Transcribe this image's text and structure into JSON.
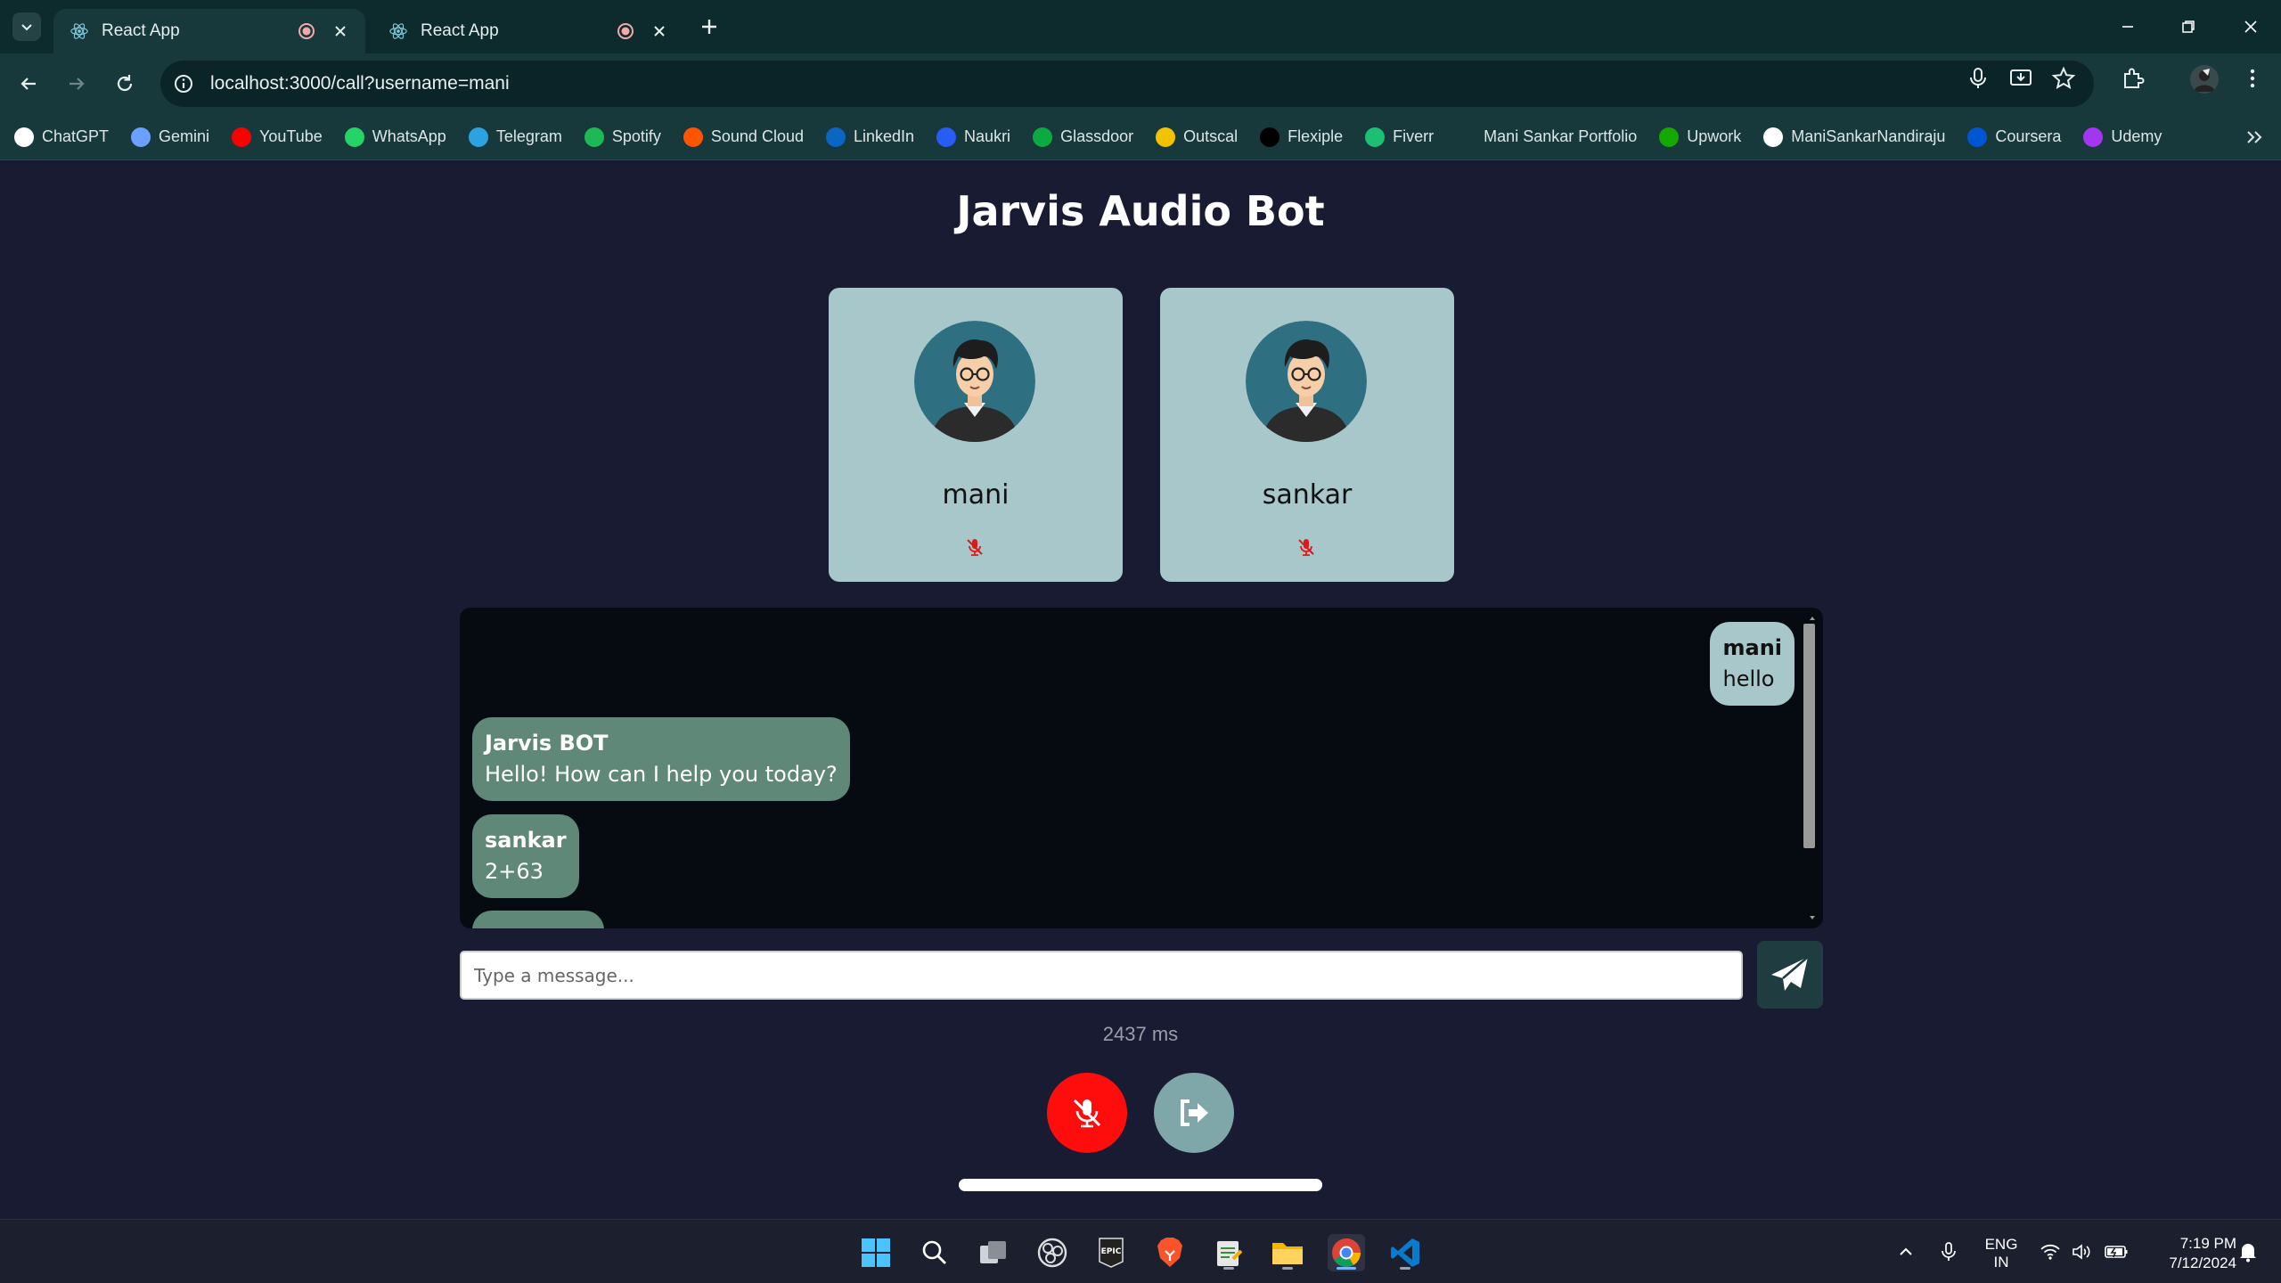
{
  "browser": {
    "tabs": [
      {
        "title": "React App",
        "active": true,
        "recording": true
      },
      {
        "title": "React App",
        "active": false,
        "recording": true
      }
    ],
    "url": "localhost:3000/call?username=mani",
    "bookmarks": [
      {
        "label": "ChatGPT",
        "icon": "chatgpt-icon",
        "color": "#ffffff"
      },
      {
        "label": "Gemini",
        "icon": "gemini-icon",
        "color": "#6aa0ff"
      },
      {
        "label": "YouTube",
        "icon": "youtube-icon",
        "color": "#ff0000"
      },
      {
        "label": "WhatsApp",
        "icon": "whatsapp-icon",
        "color": "#25d366"
      },
      {
        "label": "Telegram",
        "icon": "telegram-icon",
        "color": "#2aa3e0"
      },
      {
        "label": "Spotify",
        "icon": "spotify-icon",
        "color": "#1db954"
      },
      {
        "label": "Sound Cloud",
        "icon": "soundcloud-icon",
        "color": "#ff5500"
      },
      {
        "label": "LinkedIn",
        "icon": "linkedin-icon",
        "color": "#0a66c2"
      },
      {
        "label": "Naukri",
        "icon": "naukri-icon",
        "color": "#275df5"
      },
      {
        "label": "Glassdoor",
        "icon": "glassdoor-icon",
        "color": "#0caa41"
      },
      {
        "label": "Outscal",
        "icon": "outscal-icon",
        "color": "#f2c200"
      },
      {
        "label": "Flexiple",
        "icon": "flexiple-icon",
        "color": "#000000"
      },
      {
        "label": "Fiverr",
        "icon": "fiverr-icon",
        "color": "#1dbf73"
      },
      {
        "label": "Mani Sankar Portfolio",
        "icon": "portfolio-icon",
        "color": "#18393c"
      },
      {
        "label": "Upwork",
        "icon": "upwork-icon",
        "color": "#14a800"
      },
      {
        "label": "ManiSankarNandiraju",
        "icon": "github-icon",
        "color": "#ffffff"
      },
      {
        "label": "Coursera",
        "icon": "coursera-icon",
        "color": "#0056d2"
      },
      {
        "label": "Udemy",
        "icon": "udemy-icon",
        "color": "#a435f0"
      }
    ]
  },
  "app": {
    "title": "Jarvis Audio Bot",
    "participants": [
      {
        "name": "mani",
        "muted": true
      },
      {
        "name": "sankar",
        "muted": true
      }
    ],
    "messages": [
      {
        "sender": "mani",
        "text": "hello",
        "self": true
      },
      {
        "sender": "Jarvis BOT",
        "text": "Hello! How can I help you today?",
        "self": false
      },
      {
        "sender": "sankar",
        "text": "2+63",
        "self": false
      }
    ],
    "input_placeholder": "Type a message...",
    "latency": "2437 ms",
    "colors": {
      "mute": "#ff0d0d",
      "leave": "#7fa6a9",
      "card": "#a7c7ca",
      "bubble": "#5f8878"
    }
  },
  "taskbar": {
    "lang_line1": "ENG",
    "lang_line2": "IN",
    "time": "7:19 PM",
    "date": "7/12/2024"
  }
}
